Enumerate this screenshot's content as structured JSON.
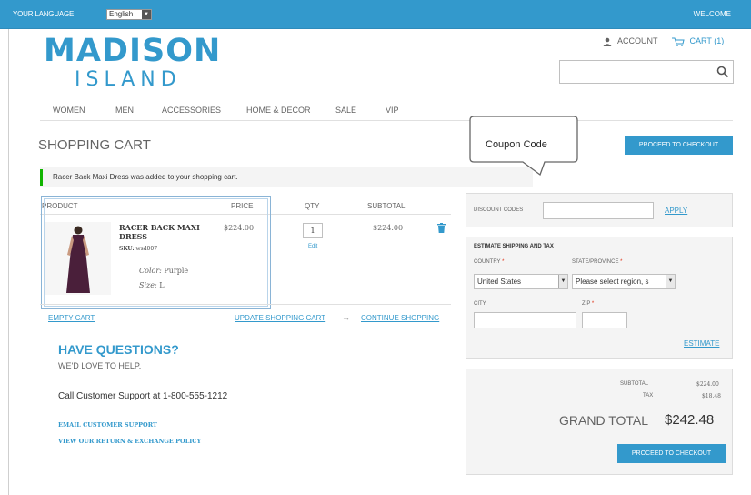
{
  "topbar": {
    "language_label": "Your Language:",
    "language_value": "English",
    "welcome": "Welcome"
  },
  "logo": {
    "line1": "MADISON",
    "line2": "ISLAND"
  },
  "header": {
    "account": "Account",
    "cart": "Cart (1)",
    "search_placeholder": ""
  },
  "nav": [
    "Women",
    "Men",
    "Accessories",
    "Home & Decor",
    "Sale",
    "VIP"
  ],
  "page": {
    "title": "Shopping Cart",
    "checkout_top": "Proceed to Checkout",
    "success_message": "Racer Back Maxi Dress was added to your shopping cart."
  },
  "table": {
    "headers": {
      "product": "Product",
      "price": "Price",
      "qty": "Qty",
      "subtotal": "Subtotal"
    },
    "item": {
      "name": "Racer Back Maxi Dress",
      "sku_label": "SKU:",
      "sku": "wsd007",
      "color_label": "Color:",
      "color": "Purple",
      "size_label": "Size:",
      "size": "L",
      "price": "$224.00",
      "qty": "1",
      "edit": "Edit",
      "subtotal": "$224.00"
    }
  },
  "actions": {
    "empty_cart": "Empty Cart",
    "update_cart": "Update Shopping Cart",
    "separator": "→",
    "continue": "Continue Shopping"
  },
  "questions": {
    "title": "Have Questions?",
    "subtitle": "We'd love to help.",
    "phone": "Call Customer Support at 1-800-555-1212",
    "email_link": "Email Customer Support",
    "policy_link": "View our Return & Exchange Policy"
  },
  "callout": {
    "text": "Coupon Code"
  },
  "discount": {
    "label": "Discount Codes",
    "input_value": "",
    "apply": "Apply"
  },
  "estimate": {
    "title": "Estimate Shipping and Tax",
    "country_label": "Country",
    "country_value": "United States",
    "state_label": "State/Province",
    "state_value": "Please select region, s",
    "city_label": "City",
    "zip_label": "Zip",
    "required_mark": "*",
    "estimate_link": "Estimate"
  },
  "totals": {
    "subtotal_label": "Subtotal",
    "subtotal_value": "$224.00",
    "tax_label": "Tax",
    "tax_value": "$18.48",
    "grand_label": "Grand Total",
    "grand_value": "$242.48",
    "checkout_bottom": "Proceed to Checkout"
  },
  "colors": {
    "accent": "#3399cc",
    "success": "#11b400",
    "required": "#df280a",
    "panel_bg": "#f4f4f4"
  },
  "icons": {
    "account": "person-icon",
    "cart": "cart-icon",
    "search": "magnifier-icon",
    "remove": "trash-icon"
  }
}
